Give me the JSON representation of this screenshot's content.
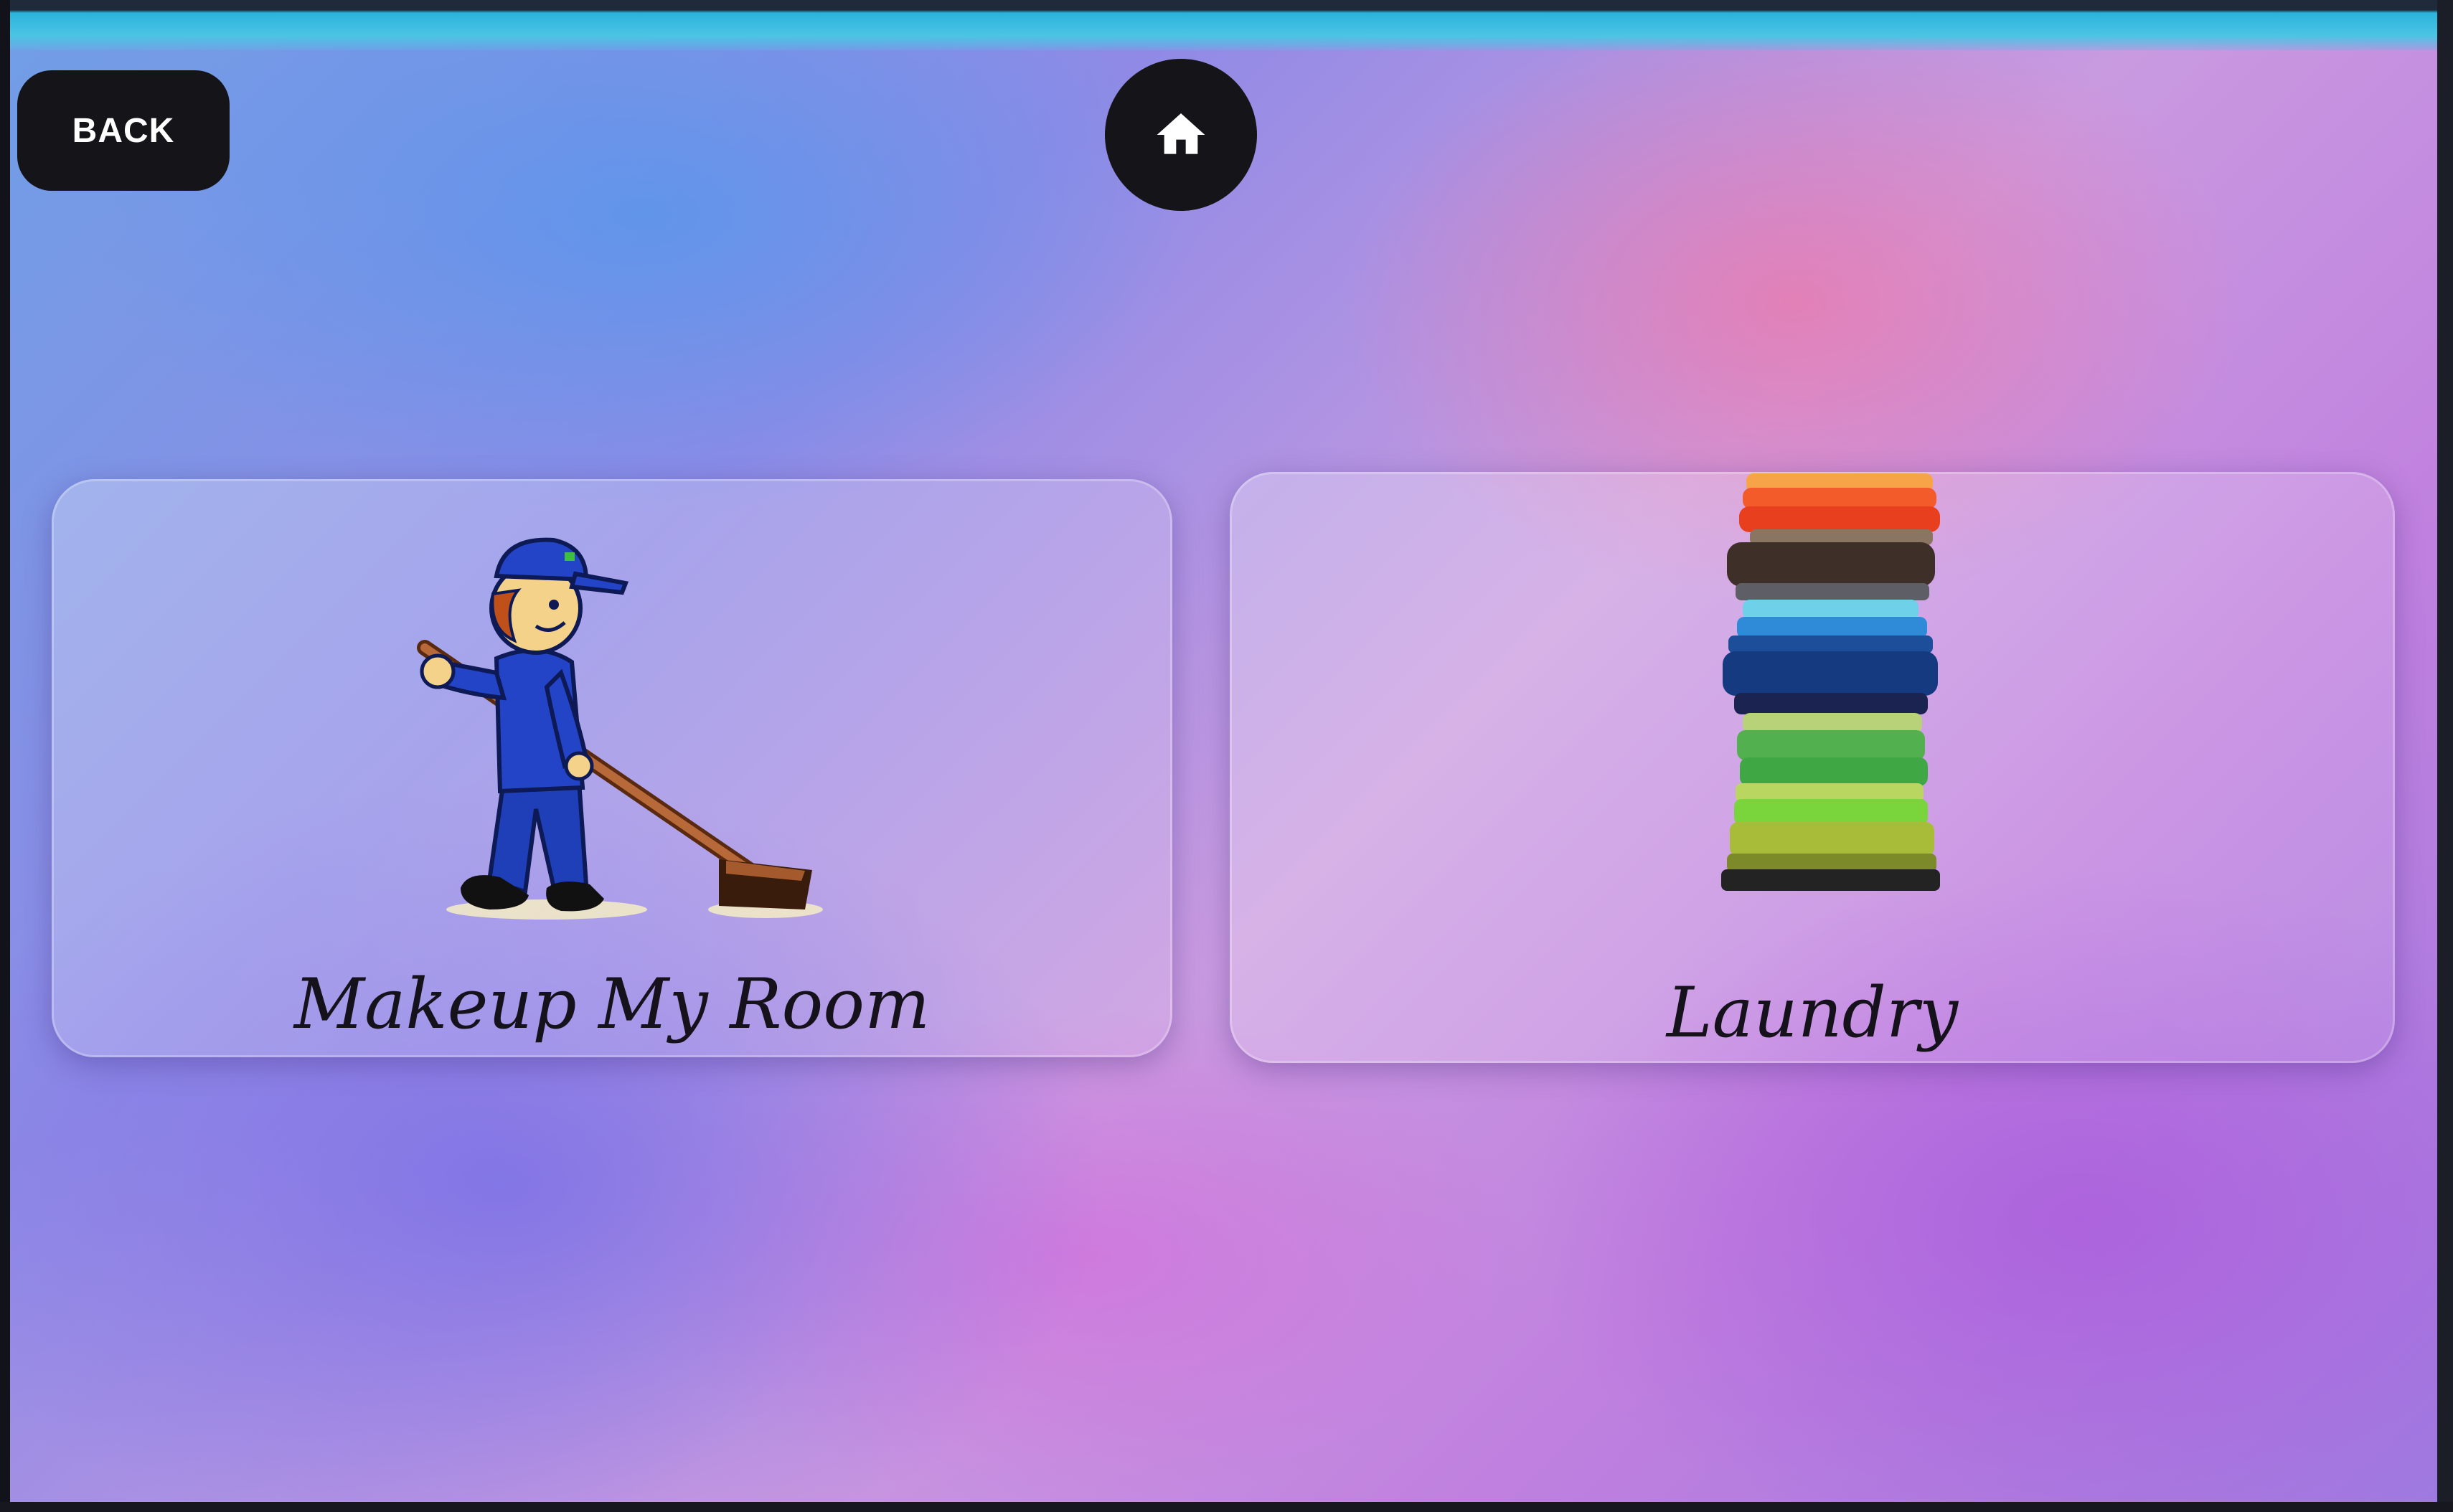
{
  "nav": {
    "back_label": "BACK",
    "home_icon": "home-icon"
  },
  "options": [
    {
      "label": "Makeup My Room",
      "icon": "janitor-sweeping-icon"
    },
    {
      "label": "Laundry",
      "icon": "folded-clothes-stack-icon"
    }
  ],
  "colors": {
    "button_bg": "#141419",
    "button_text": "#ffffff",
    "title_text": "#16121c"
  }
}
